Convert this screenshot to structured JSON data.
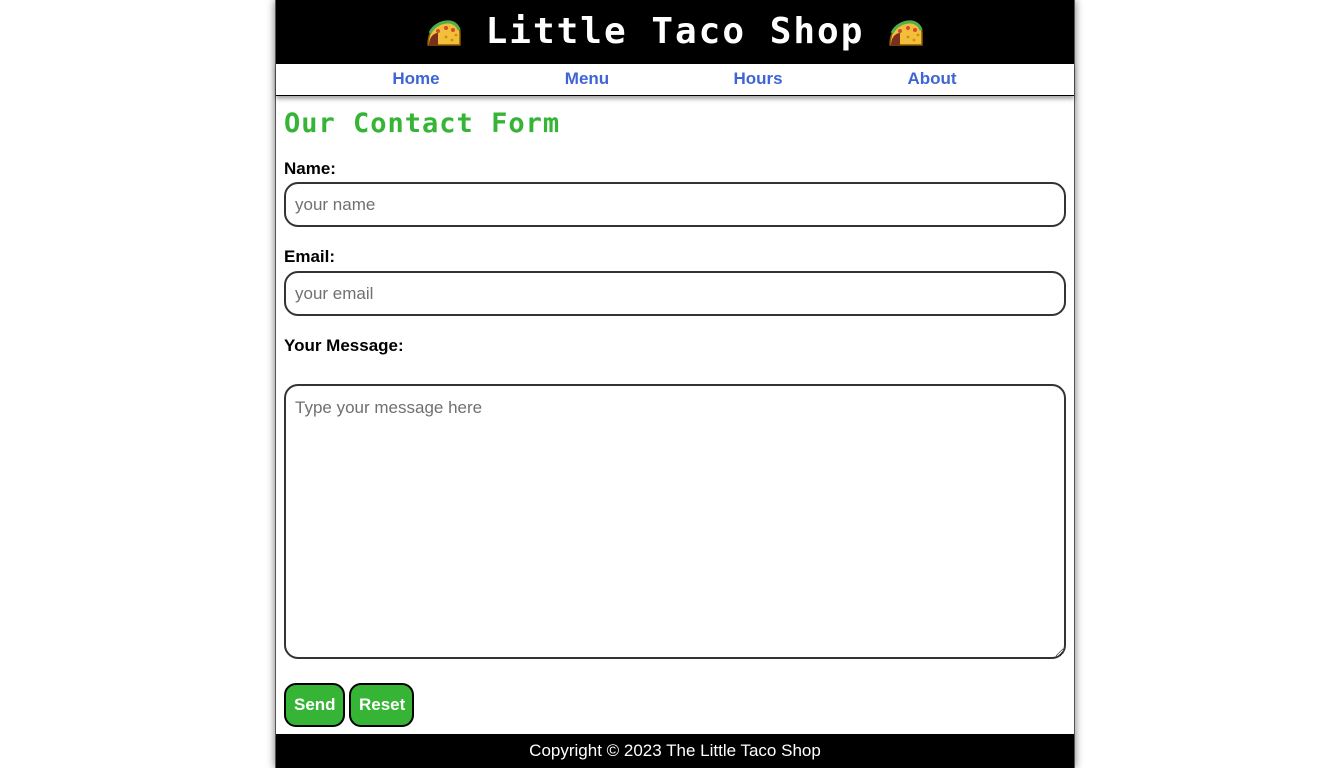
{
  "header": {
    "title": "Little Taco Shop",
    "left_icon": "taco-icon",
    "right_icon": "taco-icon",
    "background": "#000000"
  },
  "nav": {
    "items": [
      {
        "label": "Home"
      },
      {
        "label": "Menu"
      },
      {
        "label": "Hours"
      },
      {
        "label": "About"
      }
    ],
    "link_color": "#3f64d6"
  },
  "form": {
    "title": "Our Contact Form",
    "title_color": "#35b435",
    "name": {
      "label": "Name:",
      "placeholder": "your name",
      "value": ""
    },
    "email": {
      "label": "Email:",
      "placeholder": "your email",
      "value": ""
    },
    "message": {
      "label": "Your Message:",
      "placeholder": "Type your message here",
      "value": ""
    },
    "send_label": "Send",
    "reset_label": "Reset",
    "button_color": "#35b435"
  },
  "footer": {
    "text": "Copyright © 2023 The Little Taco Shop"
  }
}
